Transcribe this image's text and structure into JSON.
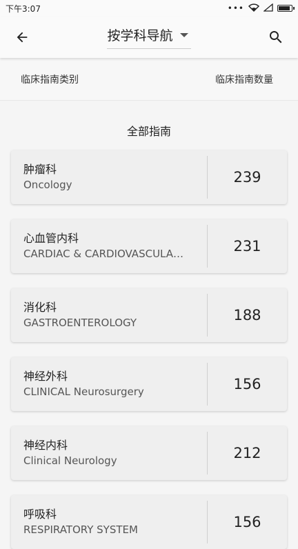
{
  "status_bar": {
    "time": "下午3:07",
    "dots": "•••"
  },
  "app_bar": {
    "title": "按学科导航",
    "back_icon": "arrow-left-icon",
    "search_icon": "search-icon",
    "dropdown_icon": "caret-down-icon"
  },
  "header": {
    "left": "临床指南类别",
    "right": "临床指南数量"
  },
  "section_title": "全部指南",
  "categories": [
    {
      "zh": "肿瘤科",
      "en": "Oncology",
      "count": "239"
    },
    {
      "zh": "心血管内科",
      "en": "CARDIAC & CARDIOVASCULA…",
      "count": "231"
    },
    {
      "zh": "消化科",
      "en": "GASTROENTEROLOGY",
      "count": "188"
    },
    {
      "zh": "神经外科",
      "en": "CLINICAL Neurosurgery",
      "count": "156"
    },
    {
      "zh": "神经内科",
      "en": "Clinical Neurology",
      "count": "212"
    },
    {
      "zh": "呼吸科",
      "en": "RESPIRATORY SYSTEM",
      "count": "156"
    }
  ]
}
